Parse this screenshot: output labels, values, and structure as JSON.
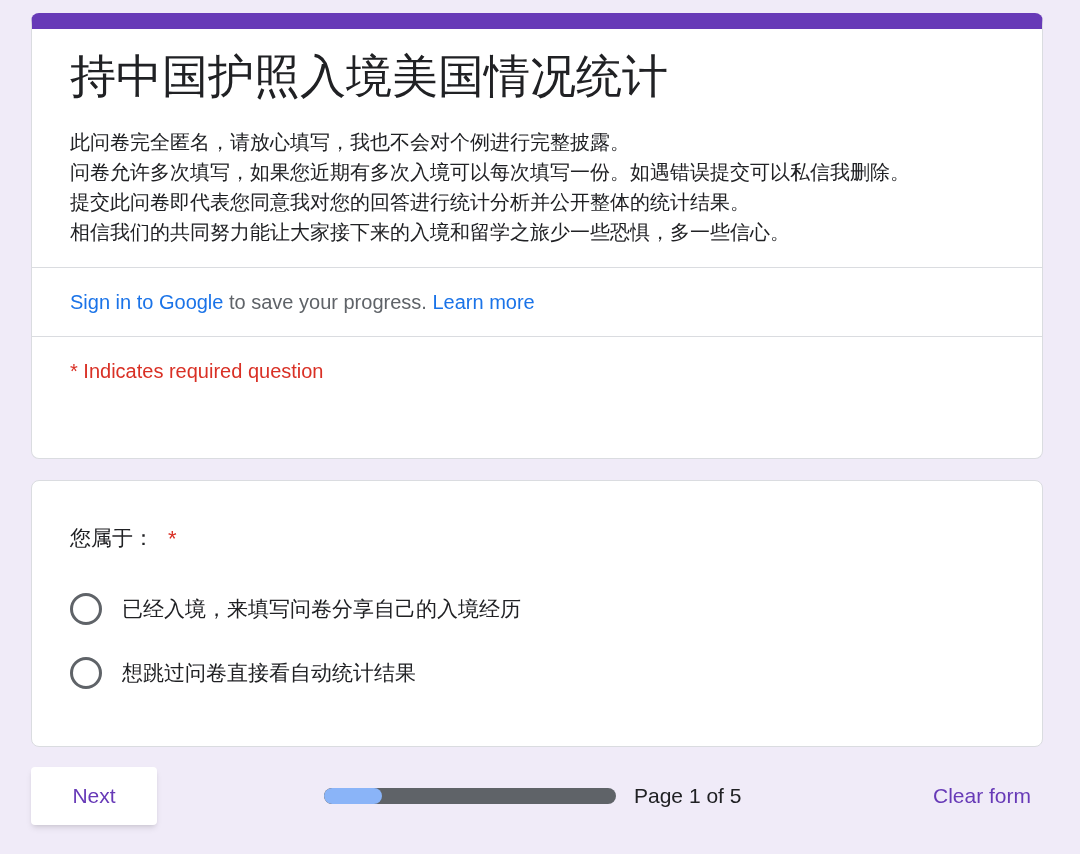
{
  "header": {
    "title": "持中国护照入境美国情况统计",
    "description": [
      "此问卷完全匿名，请放心填写，我也不会对个例进行完整披露。",
      "问卷允许多次填写，如果您近期有多次入境可以每次填写一份。如遇错误提交可以私信我删除。",
      "提交此问卷即代表您同意我对您的回答进行统计分析并公开整体的统计结果。",
      "相信我们的共同努力能让大家接下来的入境和留学之旅少一些恐惧，多一些信心。"
    ],
    "signin": {
      "link": "Sign in to Google",
      "text": "to save your progress.",
      "learn_more": "Learn more"
    },
    "required_note": "* Indicates required question"
  },
  "question": {
    "label": "您属于：",
    "required_mark": "*",
    "options": [
      {
        "label": "已经入境，来填写问卷分享自己的入境经历",
        "selected": false
      },
      {
        "label": "想跳过问卷直接看自动统计结果",
        "selected": false
      }
    ]
  },
  "footer": {
    "next": "Next",
    "progress": {
      "level": 0.2
    },
    "page": "Page 1 of 5",
    "clear": "Clear form"
  }
}
